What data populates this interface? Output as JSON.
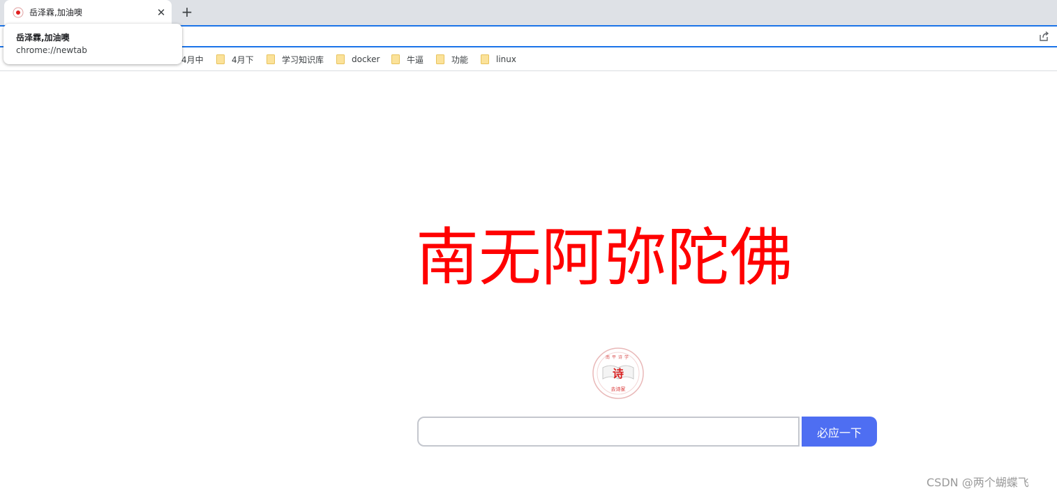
{
  "browser": {
    "tab": {
      "title": "岳泽霖,加油噢",
      "close_glyph": "✕",
      "favicon": "poetry-seal-icon"
    },
    "new_tab_glyph": "+",
    "hover_card": {
      "title": "岳泽霖,加油噢",
      "url": "chrome://newtab"
    },
    "omnibox_value": "",
    "accent": "#1a73e8"
  },
  "bookmarks": [
    {
      "label": "4月中",
      "icon": "folder-icon"
    },
    {
      "label": "4月下",
      "icon": "folder-icon"
    },
    {
      "label": "学习知识库",
      "icon": "folder-icon"
    },
    {
      "label": "docker",
      "icon": "folder-icon"
    },
    {
      "label": "牛逼",
      "icon": "folder-icon"
    },
    {
      "label": "功能",
      "icon": "folder-icon"
    },
    {
      "label": "linux",
      "icon": "folder-icon"
    }
  ],
  "page": {
    "headline": "南无阿弥陀佛",
    "headline_color": "#ff0000",
    "logo": {
      "center_char": "诗",
      "top_text": "南平诗学",
      "bottom_text": "去诗家"
    },
    "search": {
      "value": "",
      "button_label": "必应一下",
      "button_color": "#4e6ef2"
    },
    "watermark": "CSDN @两个蝴蝶飞"
  }
}
